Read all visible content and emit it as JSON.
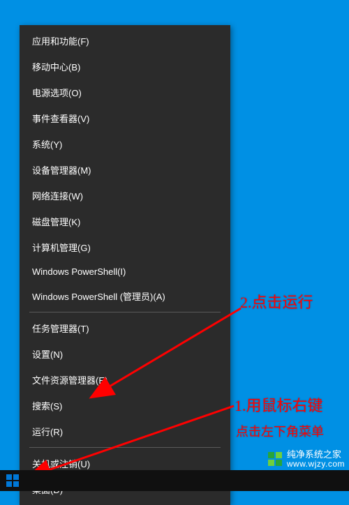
{
  "menu": {
    "groups": [
      [
        {
          "label": "应用和功能(F)",
          "name": "menu-apps-features"
        },
        {
          "label": "移动中心(B)",
          "name": "menu-mobility-center"
        },
        {
          "label": "电源选项(O)",
          "name": "menu-power-options"
        },
        {
          "label": "事件查看器(V)",
          "name": "menu-event-viewer"
        },
        {
          "label": "系统(Y)",
          "name": "menu-system"
        },
        {
          "label": "设备管理器(M)",
          "name": "menu-device-manager"
        },
        {
          "label": "网络连接(W)",
          "name": "menu-network-connections"
        },
        {
          "label": "磁盘管理(K)",
          "name": "menu-disk-management"
        },
        {
          "label": "计算机管理(G)",
          "name": "menu-computer-management"
        },
        {
          "label": "Windows PowerShell(I)",
          "name": "menu-powershell"
        },
        {
          "label": "Windows PowerShell (管理员)(A)",
          "name": "menu-powershell-admin"
        }
      ],
      [
        {
          "label": "任务管理器(T)",
          "name": "menu-task-manager"
        },
        {
          "label": "设置(N)",
          "name": "menu-settings"
        },
        {
          "label": "文件资源管理器(E)",
          "name": "menu-file-explorer"
        },
        {
          "label": "搜索(S)",
          "name": "menu-search"
        },
        {
          "label": "运行(R)",
          "name": "menu-run"
        }
      ],
      [
        {
          "label": "关机或注销(U)",
          "name": "menu-shutdown-signout"
        },
        {
          "label": "桌面(D)",
          "name": "menu-desktop"
        }
      ]
    ]
  },
  "annotations": {
    "step2": "2.点击运行",
    "step1_line1": "1.用鼠标右键",
    "step1_line2": "点击左下角菜单"
  },
  "watermark": {
    "brand": "纯净系统之家",
    "url": "www.wjzy.com"
  }
}
